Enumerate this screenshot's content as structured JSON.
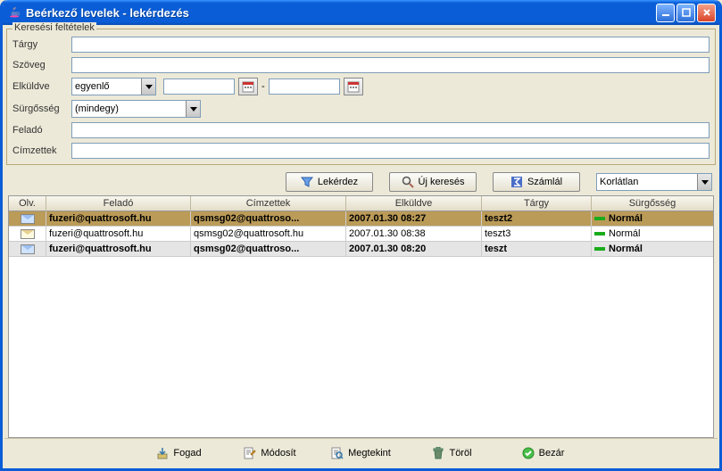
{
  "window": {
    "title": "Beérkező levelek - lekérdezés"
  },
  "fieldset": {
    "legend": "Keresési feltételek"
  },
  "labels": {
    "targy": "Tárgy",
    "szoveg": "Szöveg",
    "elkuldve": "Elküldve",
    "surgosseg": "Sürgősség",
    "felado": "Feladó",
    "cimzettek": "Címzettek"
  },
  "fields": {
    "targy": "",
    "szoveg": "",
    "compare": "egyenlő",
    "date1": "",
    "date2": "",
    "surg": "(mindegy)",
    "felado": "",
    "cimzettek": ""
  },
  "midbuttons": {
    "lekerdez": "Lekérdez",
    "ujkereses": "Új keresés",
    "szamlal": "Számlál",
    "limit": "Korlátlan"
  },
  "columns": {
    "olv": "Olv.",
    "felado": "Feladó",
    "cimzettek": "Címzettek",
    "elkuldve": "Elküldve",
    "targy": "Tárgy",
    "surgosseg": "Sürgősség"
  },
  "rows": [
    {
      "felado": "fuzeri@quattrosoft.hu",
      "cimzettek": "qsmsg02@quattroso...",
      "elkuldve": "2007.01.30 08:27",
      "targy": "teszt2",
      "surgosseg": "Normál"
    },
    {
      "felado": "fuzeri@quattrosoft.hu",
      "cimzettek": "qsmsg02@quattrosoft.hu",
      "elkuldve": "2007.01.30 08:38",
      "targy": "teszt3",
      "surgosseg": "Normál"
    },
    {
      "felado": "fuzeri@quattrosoft.hu",
      "cimzettek": "qsmsg02@quattroso...",
      "elkuldve": "2007.01.30 08:20",
      "targy": "teszt",
      "surgosseg": "Normál"
    }
  ],
  "bottom": {
    "fogad": "Fogad",
    "modosit": "Módosít",
    "megtekint": "Megtekint",
    "torol": "Töröl",
    "bezar": "Bezár"
  },
  "dash": "-"
}
